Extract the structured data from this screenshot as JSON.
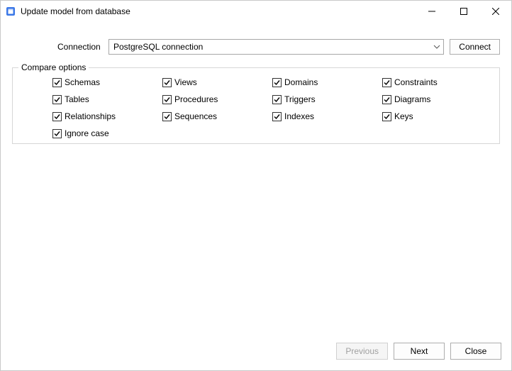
{
  "window": {
    "title": "Update model from database"
  },
  "connection": {
    "label": "Connection",
    "selected": "PostgreSQL connection",
    "connect_label": "Connect"
  },
  "compare": {
    "legend": "Compare options",
    "options": {
      "schemas": {
        "label": "Schemas",
        "checked": true
      },
      "tables": {
        "label": "Tables",
        "checked": true
      },
      "relationships": {
        "label": "Relationships",
        "checked": true
      },
      "ignore_case": {
        "label": "Ignore case",
        "checked": true
      },
      "views": {
        "label": "Views",
        "checked": true
      },
      "procedures": {
        "label": "Procedures",
        "checked": true
      },
      "sequences": {
        "label": "Sequences",
        "checked": true
      },
      "domains": {
        "label": "Domains",
        "checked": true
      },
      "triggers": {
        "label": "Triggers",
        "checked": true
      },
      "indexes": {
        "label": "Indexes",
        "checked": true
      },
      "constraints": {
        "label": "Constraints",
        "checked": true
      },
      "diagrams": {
        "label": "Diagrams",
        "checked": true
      },
      "keys": {
        "label": "Keys",
        "checked": true
      }
    }
  },
  "footer": {
    "previous": "Previous",
    "next": "Next",
    "close": "Close"
  }
}
